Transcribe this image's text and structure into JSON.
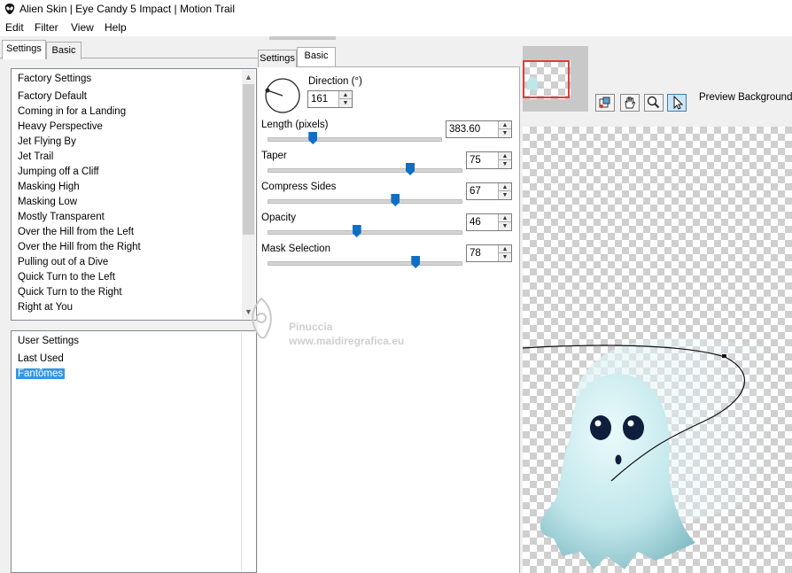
{
  "window": {
    "title": "Alien Skin | Eye Candy 5 Impact | Motion Trail"
  },
  "menu": [
    "Edit",
    "Filter",
    "View",
    "Help"
  ],
  "left_tabs": [
    "Settings",
    "Basic"
  ],
  "factory_settings": {
    "header": "Factory Settings",
    "items": [
      "Factory Default",
      "Coming in for a Landing",
      "Heavy Perspective",
      "Jet Flying By",
      "Jet Trail",
      "Jumping off a Cliff",
      "Masking High",
      "Masking Low",
      "Mostly Transparent",
      "Over the Hill from the Left",
      "Over the Hill from the Right",
      "Pulling out of a Dive",
      "Quick Turn to the Left",
      "Quick Turn to the Right",
      "Right at You"
    ]
  },
  "user_settings": {
    "header": "User Settings",
    "items": [
      "Last Used",
      "Fantômes"
    ],
    "selected": "Fantômes"
  },
  "middle_tabs": [
    "Settings",
    "Basic"
  ],
  "controls": {
    "direction": {
      "label": "Direction (°)",
      "value": "161"
    },
    "length": {
      "label": "Length (pixels)",
      "value": "383.60",
      "fraction": 0.25
    },
    "taper": {
      "label": "Taper",
      "value": "75",
      "fraction": 0.75
    },
    "compress_sides": {
      "label": "Compress Sides",
      "value": "67",
      "fraction": 0.67
    },
    "opacity": {
      "label": "Opacity",
      "value": "46",
      "fraction": 0.46
    },
    "mask_selection": {
      "label": "Mask Selection",
      "value": "78",
      "fraction": 0.78
    }
  },
  "preview": {
    "background_label": "Preview Background:",
    "tools": [
      "bucket-icon",
      "hand-icon",
      "zoom-icon",
      "pointer-icon"
    ],
    "active_tool": "pointer-icon"
  },
  "watermark": {
    "line1": "Pinuccia",
    "line2": "www.maidiregrafica.eu"
  },
  "colors": {
    "selection": "#3296e6",
    "slider_thumb": "#0f6fc6",
    "ghost": "#bfe6ea",
    "nav_frame": "#e23b3b"
  }
}
